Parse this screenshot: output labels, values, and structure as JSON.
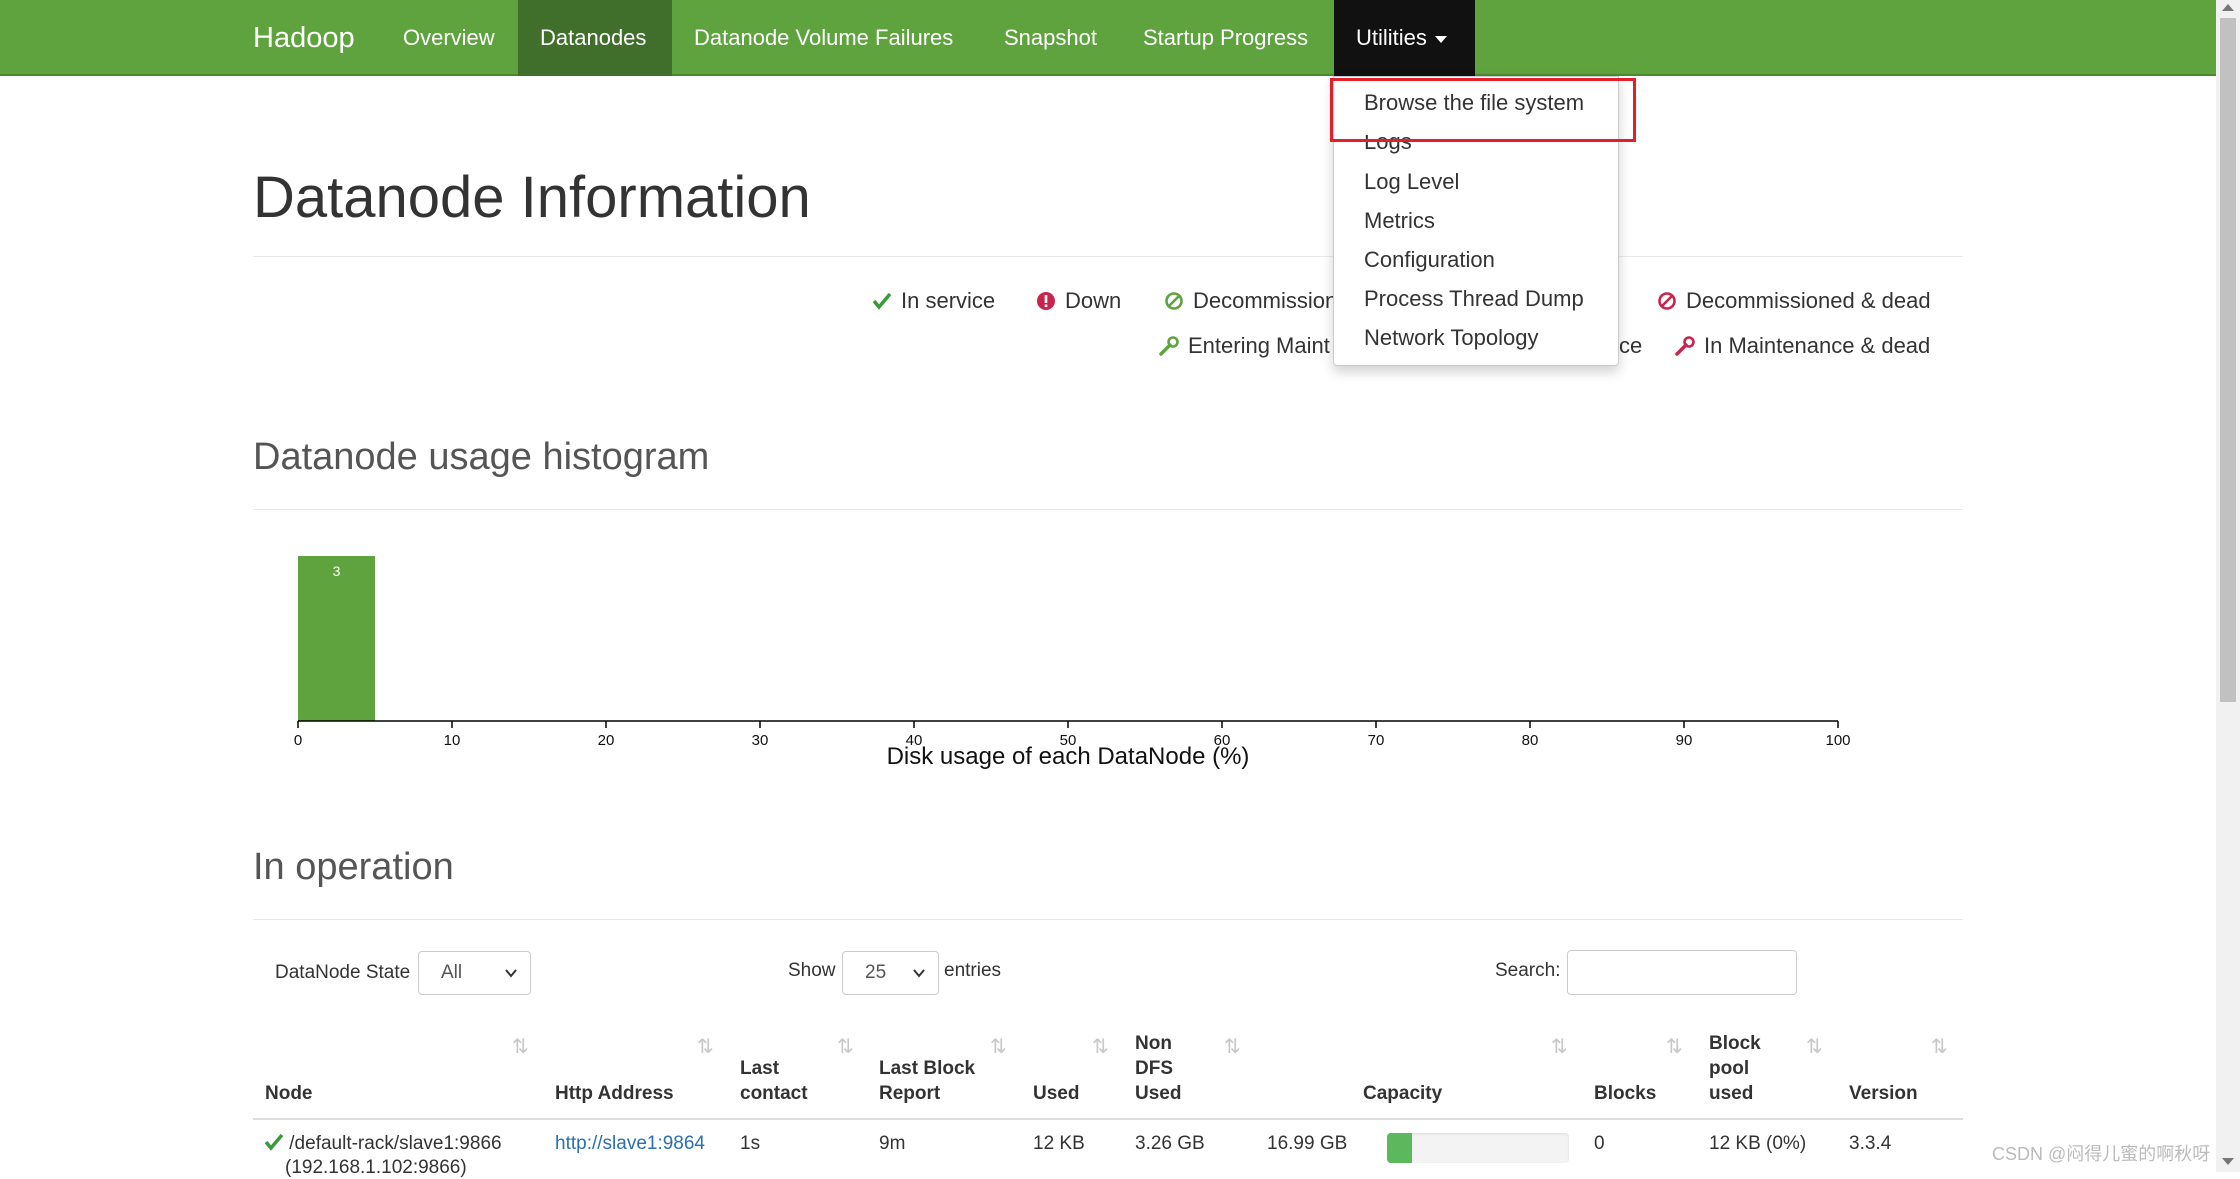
{
  "navbar": {
    "brand": "Hadoop",
    "items": [
      "Overview",
      "Datanodes",
      "Datanode Volume Failures",
      "Snapshot",
      "Startup Progress",
      "Utilities"
    ],
    "active": "Datanodes",
    "open": "Utilities"
  },
  "dropdown": {
    "items": [
      "Browse the file system",
      "Logs",
      "Log Level",
      "Metrics",
      "Configuration",
      "Process Thread Dump",
      "Network Topology"
    ],
    "highlighted": "Browse the file system"
  },
  "page": {
    "title": "Datanode Information"
  },
  "legend": {
    "in_service": "In service",
    "down": "Down",
    "decommissioned": "Decommission",
    "decommissioned_dead": "Decommissioned & dead",
    "entering_maintenance": "Entering Maint",
    "in_maintenance_suffix": "ce",
    "in_maintenance_dead": "In Maintenance & dead"
  },
  "histogram": {
    "title": "Datanode usage histogram"
  },
  "chart_data": {
    "type": "bar",
    "bins": [
      [
        0,
        5
      ]
    ],
    "values": [
      3
    ],
    "xlabel": "Disk usage of each DataNode (%)",
    "xlim": [
      0,
      100
    ],
    "xticks": [
      0,
      10,
      20,
      30,
      40,
      50,
      60,
      70,
      80,
      90,
      100
    ]
  },
  "operation": {
    "title": "In operation",
    "state_label": "DataNode State",
    "state_value": "All",
    "show_label": "Show",
    "show_value": "25",
    "entries_label": "entries",
    "search_label": "Search:",
    "search_value": ""
  },
  "table": {
    "headers": [
      "Node",
      "Http Address",
      "Last contact",
      "Last Block Report",
      "Used",
      "Non DFS Used",
      "Capacity",
      "Blocks",
      "Block pool used",
      "Version"
    ],
    "rows": [
      {
        "node": "/default-rack/slave1:9866",
        "node_sub": "(192.168.1.102:9866)",
        "http": "http://slave1:9864",
        "last_contact": "1s",
        "last_block_report": "9m",
        "used": "12 KB",
        "non_dfs_used": "3.26 GB",
        "capacity": "16.99 GB",
        "capacity_used_fraction": 0.14,
        "blocks": "0",
        "block_pool_used": "12 KB (0%)",
        "version": "3.3.4"
      }
    ]
  },
  "watermark": "CSDN @闷得儿蜜的啊秋呀",
  "colors": {
    "navbar": "#5fa33e",
    "active": "#3f6f2a",
    "open": "#111111",
    "bar": "#5fa33e",
    "highlight": "#e0202a",
    "down": "#c7254e",
    "link": "#2a6fb0"
  }
}
